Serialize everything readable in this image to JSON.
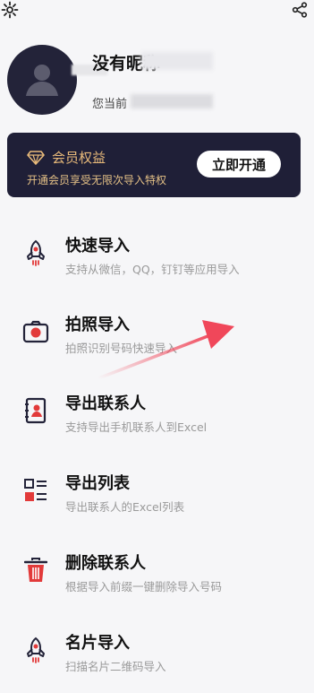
{
  "topbar": {
    "settings_icon": "gear-icon",
    "share_icon": "share-icon"
  },
  "profile": {
    "nickname": "没有昵称",
    "subtitle": "您当前"
  },
  "vip": {
    "title": "会员权益",
    "description": "开通会员享受无限次导入特权",
    "button_label": "立即开通",
    "accent_color": "#e8ba7a"
  },
  "features": [
    {
      "icon": "rocket-icon",
      "title": "快速导入",
      "desc": "支持从微信，QQ，钉钉等应用导入"
    },
    {
      "icon": "camera-icon",
      "title": "拍照导入",
      "desc": "拍照识别号码快速导入"
    },
    {
      "icon": "contact-book-icon",
      "title": "导出联系人",
      "desc": "支持导出手机联系人到Excel"
    },
    {
      "icon": "list-icon",
      "title": "导出列表",
      "desc": "导出联系人的Excel列表"
    },
    {
      "icon": "trash-icon",
      "title": "删除联系人",
      "desc": "根据导入前缀一键删除导入号码"
    },
    {
      "icon": "rocket-icon",
      "title": "名片导入",
      "desc": "扫描名片二维码导入"
    }
  ],
  "colors": {
    "dark": "#232339",
    "red": "#e23a3a",
    "annotation_arrow": "#f0475a"
  }
}
